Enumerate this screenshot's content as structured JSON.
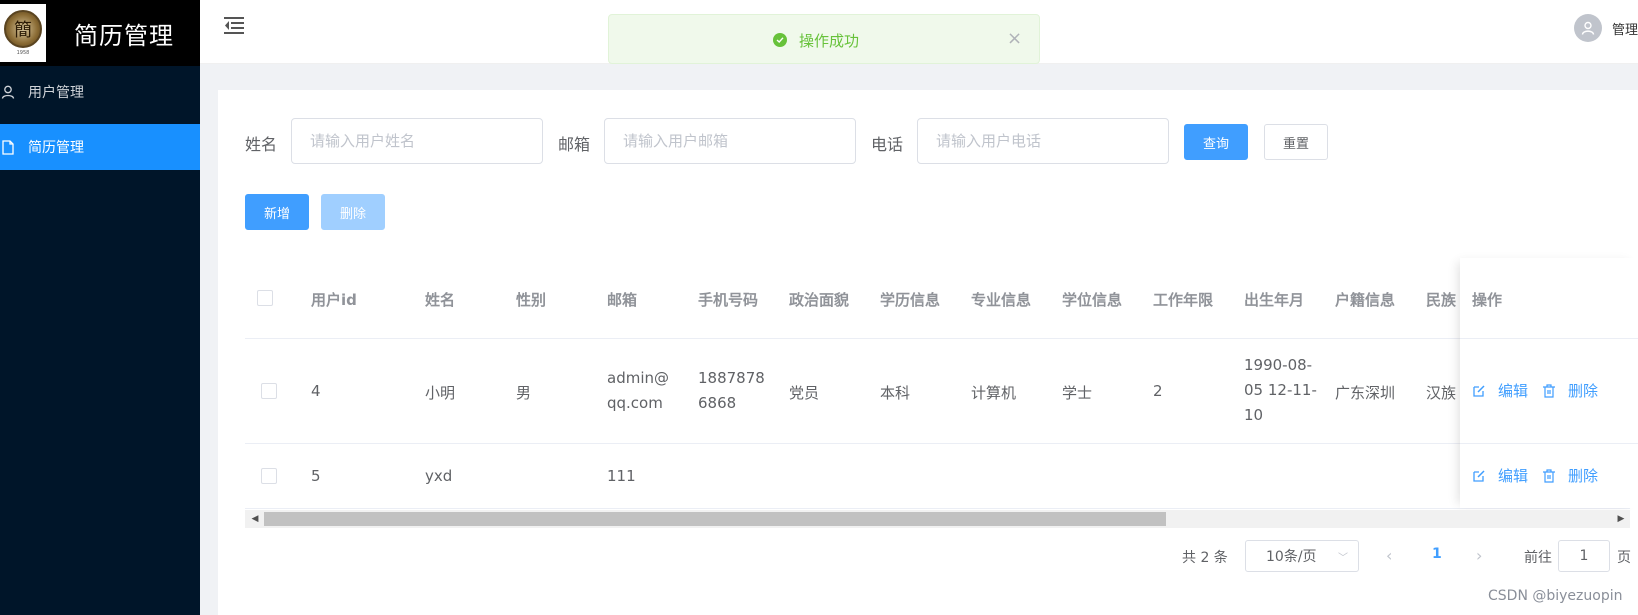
{
  "app": {
    "title": "简历管理",
    "logo_char": "簡",
    "logo_sub": "1958"
  },
  "sidebar": {
    "items": [
      {
        "label": "用户管理",
        "icon": "user-icon",
        "active": false
      },
      {
        "label": "简历管理",
        "icon": "document-icon",
        "active": true
      }
    ]
  },
  "header": {
    "user_name": "管理"
  },
  "toast": {
    "message": "操作成功",
    "type": "success"
  },
  "search": {
    "name_label": "姓名",
    "name_placeholder": "请输入用户姓名",
    "email_label": "邮箱",
    "email_placeholder": "请输入用户邮箱",
    "phone_label": "电话",
    "phone_placeholder": "请输入用户电话",
    "query_button": "查询",
    "reset_button": "重置"
  },
  "actions": {
    "add_button": "新增",
    "delete_button": "删除"
  },
  "table": {
    "columns": [
      "用户id",
      "姓名",
      "性别",
      "邮箱",
      "手机号码",
      "政治面貌",
      "学历信息",
      "专业信息",
      "学位信息",
      "工作年限",
      "出生年月",
      "户籍信息",
      "民族",
      "操作"
    ],
    "rows": [
      {
        "id": "4",
        "name": "小明",
        "gender": "男",
        "email_l1": "admin@",
        "email_l2": "qq.com",
        "phone_l1": "1887878",
        "phone_l2": "6868",
        "political": "党员",
        "education": "本科",
        "major": "计算机",
        "degree": "学士",
        "years": "2",
        "birth_l1": "1990-08-",
        "birth_l2": "05 12-11-",
        "birth_l3": "10",
        "hukou": "广东深圳",
        "ethnic": "汉族"
      },
      {
        "id": "5",
        "name": "yxd",
        "gender": "",
        "email_l1": "111"
      }
    ],
    "edit_label": "编辑",
    "delete_label": "删除"
  },
  "pagination": {
    "total": "共 2 条",
    "page_size": "10条/页",
    "current_page": "1",
    "goto_label": "前往",
    "goto_value": "1",
    "page_suffix": "页"
  },
  "watermark": "CSDN @biyezuopin",
  "colors": {
    "primary": "#409eff",
    "sidebar": "#001529",
    "active": "#1890ff",
    "success": "#67c23a"
  }
}
